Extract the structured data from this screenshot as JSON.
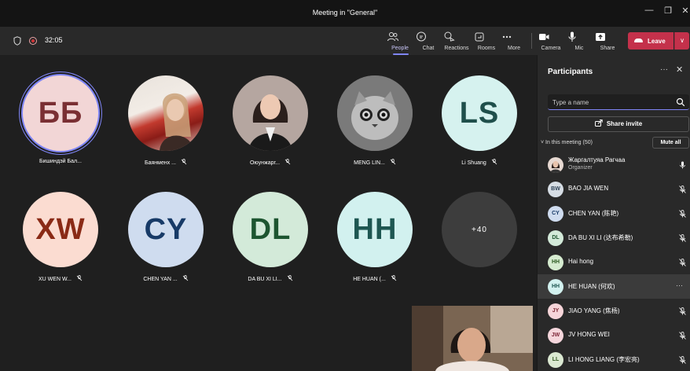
{
  "window": {
    "title": "Meeting in \"General\"",
    "minimize": "—",
    "maximize": "❐",
    "close": "✕"
  },
  "toolbar": {
    "timer": "32:05",
    "buttons": [
      {
        "label": "People"
      },
      {
        "label": "Chat"
      },
      {
        "label": "Reactions"
      },
      {
        "label": "Rooms"
      },
      {
        "label": "More"
      },
      {
        "label": "Camera"
      },
      {
        "label": "Mic"
      },
      {
        "label": "Share"
      }
    ],
    "leave_label": "Leave",
    "leave_dropdown": "∨"
  },
  "tiles": [
    {
      "initials": "ББ",
      "name": "Бишиндэй Бал..."
    },
    {
      "initials": "",
      "name": "Баянменх ..."
    },
    {
      "initials": "",
      "name": "Оюунжарг..."
    },
    {
      "initials": "",
      "name": "MENG LIN..."
    },
    {
      "initials": "LS",
      "name": "Li Shuang"
    },
    {
      "initials": "XW",
      "name": "XU WEN W..."
    },
    {
      "initials": "CY",
      "name": "CHEN YAN ..."
    },
    {
      "initials": "DL",
      "name": "DA BU XI LI..."
    },
    {
      "initials": "HH",
      "name": "HE HUAN (..."
    },
    {
      "initials": "+40",
      "name": ""
    }
  ],
  "panel": {
    "title": "Participants",
    "more": "···",
    "close": "✕",
    "search_placeholder": "Type a name",
    "share_invite": "Share invite",
    "in_meeting": "In this meeting (50)",
    "mute_all": "Mute all",
    "participants": [
      {
        "initials": "",
        "name": "Жаргалтуяа Рагчаа",
        "role": "Organizer"
      },
      {
        "initials": "BW",
        "name": "BAO JIA WEN"
      },
      {
        "initials": "CY",
        "name": "CHEN YAN (陈艳)"
      },
      {
        "initials": "DL",
        "name": "DA BU XI LI (达布希勒)"
      },
      {
        "initials": "HH",
        "name": "Hai hong"
      },
      {
        "initials": "HH",
        "name": "HE HUAN (何欢)"
      },
      {
        "initials": "JY",
        "name": "JIAO YANG (焦杨)"
      },
      {
        "initials": "JW",
        "name": "JV HONG WEI"
      },
      {
        "initials": "LL",
        "name": "LI HONG LIANG (李宏亮)"
      }
    ],
    "row_more": "···"
  }
}
